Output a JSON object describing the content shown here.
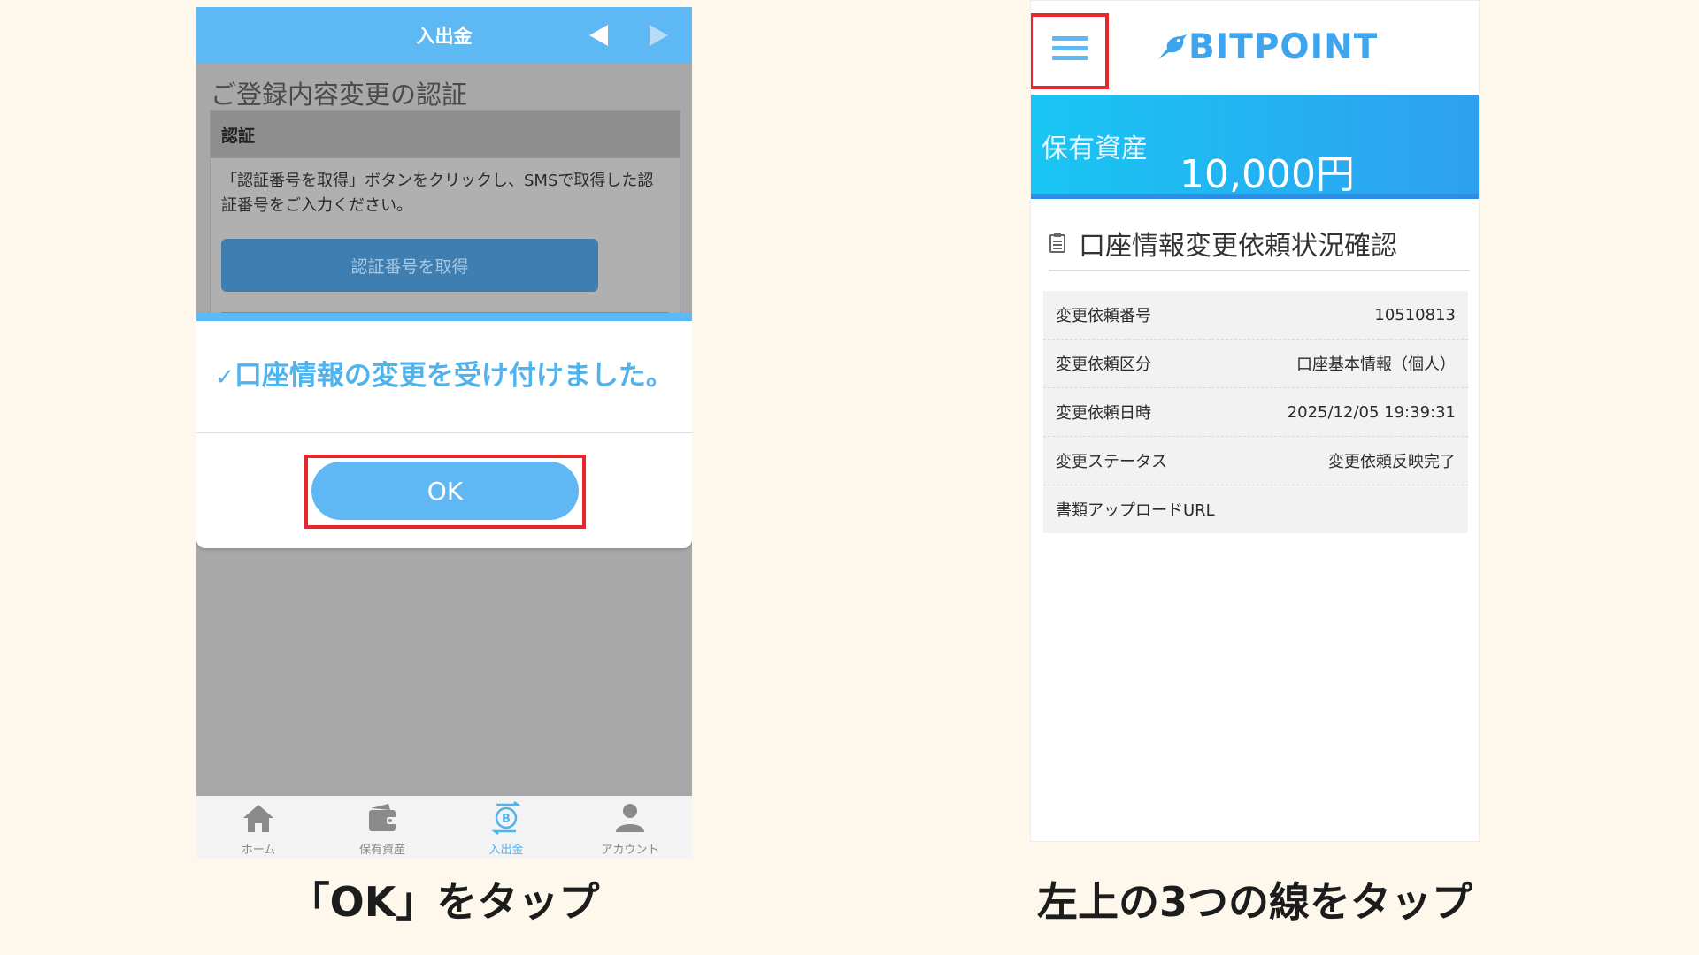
{
  "left": {
    "header_title": "入出金",
    "registration_title": "ご登録内容変更の認証",
    "auth_header": "認証",
    "auth_description": "「認証番号を取得」ボタンをクリックし、SMSで取得した認証番号をご入力ください。",
    "get_code_button": "認証番号を取得",
    "dialog": {
      "check": "✓",
      "message": "口座情報の変更を受け付けました。",
      "ok_button": "OK"
    },
    "tabs": [
      {
        "label": "ホーム",
        "icon": "home-icon"
      },
      {
        "label": "保有資産",
        "icon": "wallet-icon"
      },
      {
        "label": "入出金",
        "icon": "bitcoin-transfer-icon",
        "active": true
      },
      {
        "label": "アカウント",
        "icon": "user-icon"
      }
    ],
    "caption": "「OK」をタップ"
  },
  "right": {
    "logo_text": "BITPOINT",
    "asset_label": "保有資産",
    "asset_value": "10,000円",
    "section_title": "口座情報変更依頼状況確認",
    "rows": [
      {
        "label": "変更依頼番号",
        "value": "10510813"
      },
      {
        "label": "変更依頼区分",
        "value": "口座基本情報（個人）"
      },
      {
        "label": "変更依頼日時",
        "value": "2025/12/05 19:39:31"
      },
      {
        "label": "変更ステータス",
        "value": "変更依頼反映完了"
      },
      {
        "label": "書類アップロードURL",
        "value": ""
      }
    ],
    "caption": "左上の3つの線をタップ"
  },
  "colors": {
    "accent": "#5eb8f3",
    "highlight": "#e8262e",
    "background": "#fdf7ec"
  }
}
